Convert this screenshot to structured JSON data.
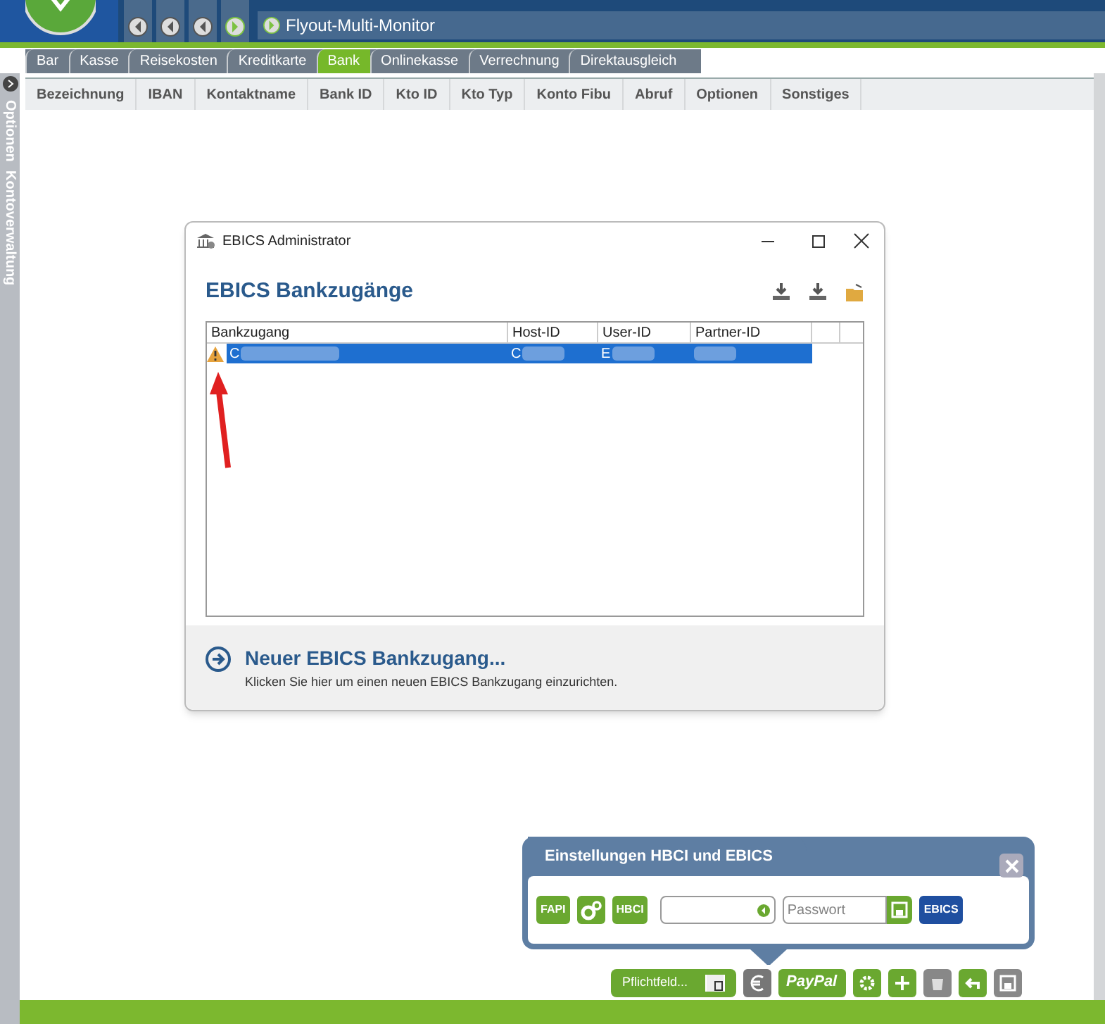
{
  "header": {
    "title": "Flyout-Multi-Monitor",
    "nav_buttons": [
      {
        "kind": "back"
      },
      {
        "kind": "back"
      },
      {
        "kind": "back"
      },
      {
        "kind": "forward"
      }
    ]
  },
  "tabs": [
    {
      "label": "Bar",
      "selected": false
    },
    {
      "label": "Kasse",
      "selected": false
    },
    {
      "label": "Reisekosten",
      "selected": false
    },
    {
      "label": "Kreditkarte",
      "selected": false
    },
    {
      "label": "Bank",
      "selected": true
    },
    {
      "label": "Onlinekasse",
      "selected": false
    },
    {
      "label": "Verrechnung",
      "selected": false
    },
    {
      "label": "Direktausgleich",
      "selected": false
    }
  ],
  "sidebar": {
    "labels": [
      "Optionen",
      "Kontoverwaltung"
    ]
  },
  "table": {
    "columns": [
      "Bezeichnung",
      "IBAN",
      "Kontaktname",
      "Bank ID",
      "Kto ID",
      "Kto Typ",
      "Konto Fibu",
      "Abruf",
      "Optionen",
      "Sonstiges"
    ]
  },
  "dialog": {
    "title": "EBICS Administrator",
    "heading": "EBICS Bankzugänge",
    "columns": [
      "Bankzugang",
      "Host-ID",
      "User-ID",
      "Partner-ID"
    ],
    "rows": [
      {
        "warning": true,
        "selected": true,
        "cells": [
          "C",
          "C",
          "E",
          ""
        ]
      }
    ],
    "new_link": "Neuer EBICS Bankzugang...",
    "new_hint": "Klicken Sie hier um einen neuen EBICS Bankzugang einzurichten."
  },
  "popup": {
    "title": "Einstellungen HBCI und EBICS",
    "buttons": [
      "FAPI",
      "HBCI"
    ],
    "password_placeholder": "Passwort",
    "ebics_button": "EBICS"
  },
  "toolbar": {
    "required_button": "Pflichtfeld...",
    "paypal_button": "PayPal"
  }
}
